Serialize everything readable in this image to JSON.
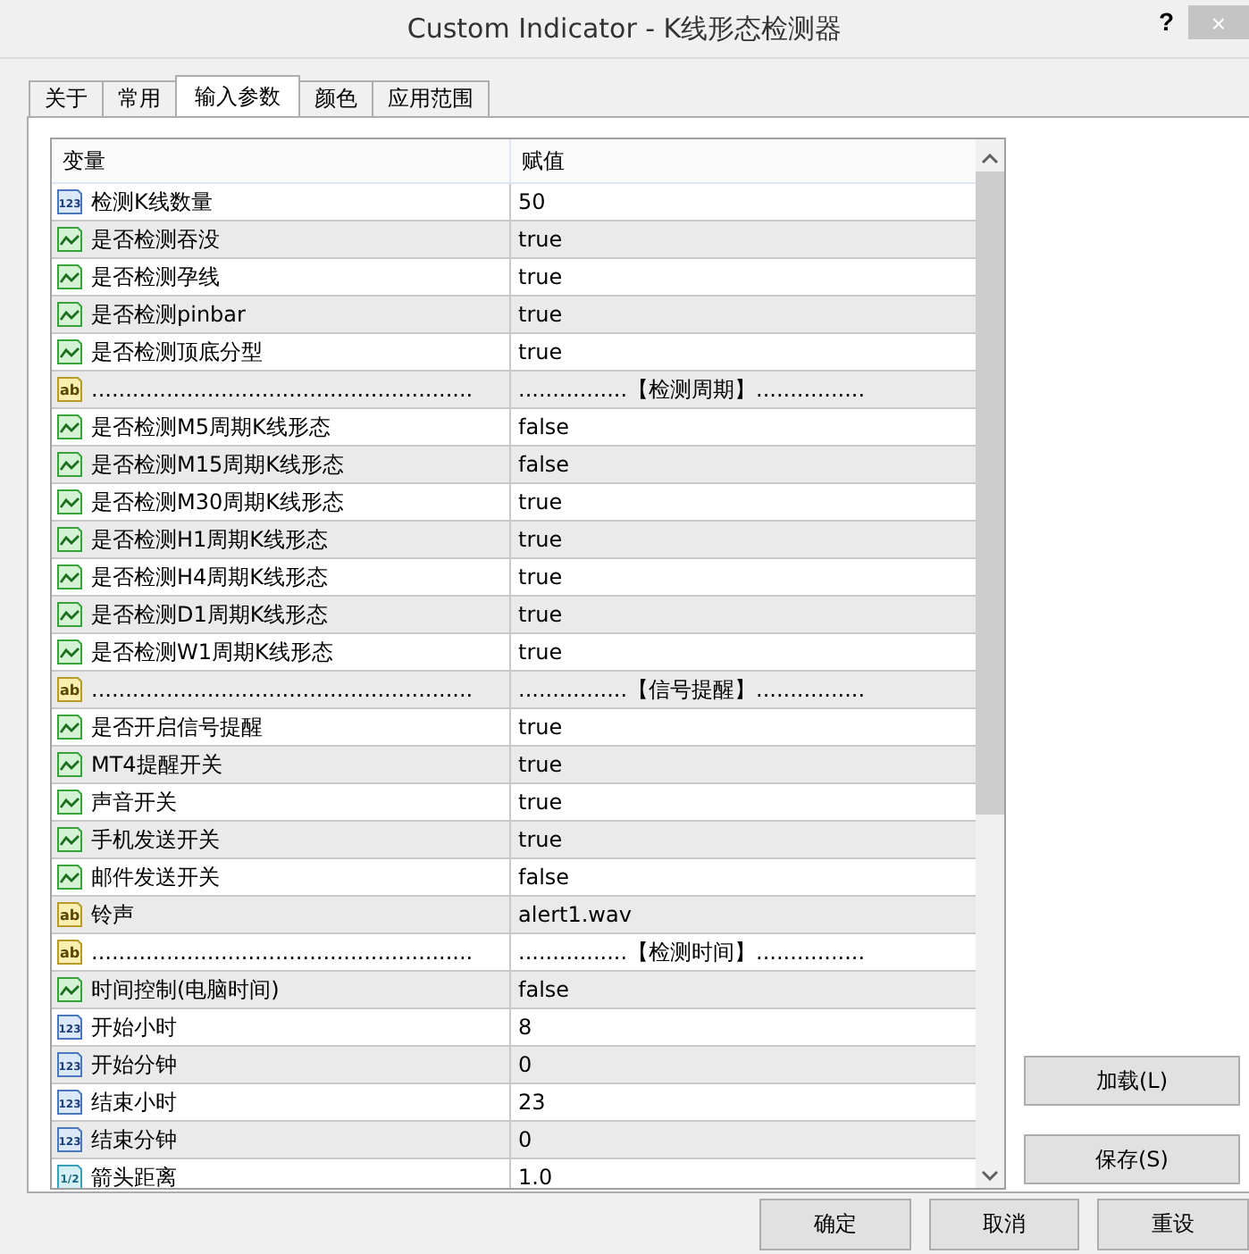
{
  "window": {
    "title": "Custom Indicator - K线形态检测器",
    "help": "?",
    "close": "×"
  },
  "tabs": [
    {
      "label": "关于",
      "selected": false
    },
    {
      "label": "常用",
      "selected": false
    },
    {
      "label": "输入参数",
      "selected": true
    },
    {
      "label": "颜色",
      "selected": false
    },
    {
      "label": "应用范围",
      "selected": false
    }
  ],
  "table": {
    "columns": [
      "变量",
      "赋值"
    ],
    "rows": [
      {
        "kind": "int",
        "icon_label": "123",
        "name": "检测K线数量",
        "value": "50"
      },
      {
        "kind": "bool",
        "name": "是否检测吞没",
        "value": "true"
      },
      {
        "kind": "bool",
        "name": "是否检测孕线",
        "value": "true"
      },
      {
        "kind": "bool",
        "name": "是否检测pinbar",
        "value": "true"
      },
      {
        "kind": "bool",
        "name": "是否检测顶底分型",
        "value": "true"
      },
      {
        "kind": "string",
        "icon_label": "ab",
        "name": "........................................................",
        "value": "................【检测周期】................"
      },
      {
        "kind": "bool",
        "name": "是否检测M5周期K线形态",
        "value": "false"
      },
      {
        "kind": "bool",
        "name": "是否检测M15周期K线形态",
        "value": "false"
      },
      {
        "kind": "bool",
        "name": "是否检测M30周期K线形态",
        "value": "true"
      },
      {
        "kind": "bool",
        "name": "是否检测H1周期K线形态",
        "value": "true"
      },
      {
        "kind": "bool",
        "name": "是否检测H4周期K线形态",
        "value": "true"
      },
      {
        "kind": "bool",
        "name": "是否检测D1周期K线形态",
        "value": "true"
      },
      {
        "kind": "bool",
        "name": "是否检测W1周期K线形态",
        "value": "true"
      },
      {
        "kind": "string",
        "icon_label": "ab",
        "name": "........................................................",
        "value": "................【信号提醒】................"
      },
      {
        "kind": "bool",
        "name": "是否开启信号提醒",
        "value": "true"
      },
      {
        "kind": "bool",
        "name": "MT4提醒开关",
        "value": "true"
      },
      {
        "kind": "bool",
        "name": "声音开关",
        "value": "true"
      },
      {
        "kind": "bool",
        "name": "手机发送开关",
        "value": "true"
      },
      {
        "kind": "bool",
        "name": "邮件发送开关",
        "value": "false"
      },
      {
        "kind": "string",
        "icon_label": "ab",
        "name": "铃声",
        "value": "alert1.wav"
      },
      {
        "kind": "string",
        "icon_label": "ab",
        "name": "........................................................",
        "value": "................【检测时间】................"
      },
      {
        "kind": "bool",
        "name": "时间控制(电脑时间)",
        "value": "false"
      },
      {
        "kind": "int",
        "icon_label": "123",
        "name": "开始小时",
        "value": "8"
      },
      {
        "kind": "int",
        "icon_label": "123",
        "name": "开始分钟",
        "value": "0"
      },
      {
        "kind": "int",
        "icon_label": "123",
        "name": "结束小时",
        "value": "23"
      },
      {
        "kind": "int",
        "icon_label": "123",
        "name": "结束分钟",
        "value": "0"
      },
      {
        "kind": "double",
        "icon_label": "1/2",
        "name": "箭头距离",
        "value": "1.0"
      }
    ]
  },
  "side_buttons": [
    "加载(L)",
    "保存(S)"
  ],
  "buttons": [
    "确定",
    "取消",
    "重设"
  ]
}
